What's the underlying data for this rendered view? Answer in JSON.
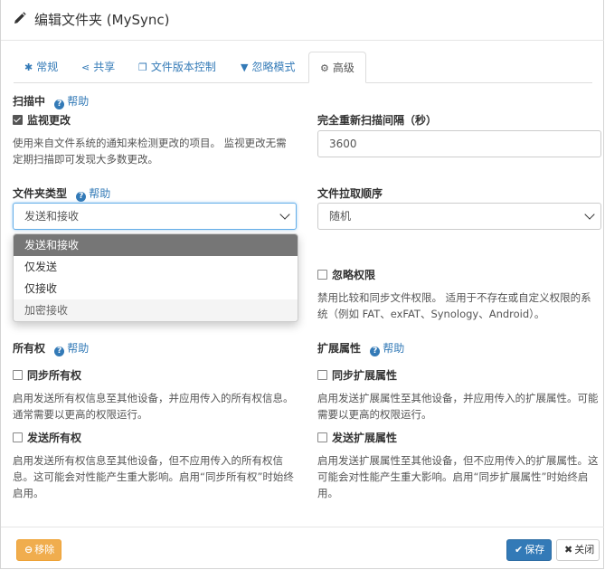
{
  "header": {
    "title": "编辑文件夹 (MySync)",
    "icon": "pencil-icon"
  },
  "tabs": [
    {
      "label": "常规",
      "icon": "gear-icon"
    },
    {
      "label": "共享",
      "icon": "share-icon"
    },
    {
      "label": "文件版本控制",
      "icon": "copy-icon"
    },
    {
      "label": "忽略模式",
      "icon": "filter-icon"
    },
    {
      "label": "高级",
      "icon": "gears-icon",
      "active": true
    }
  ],
  "help_label": "帮助",
  "scanning": {
    "title": "扫描中",
    "watch_label": "监视更改",
    "watch_checked": true,
    "watch_desc": "使用来自文件系统的通知来检测更改的项目。 监视更改无需定期扫描即可发现大多数更改。"
  },
  "rescan": {
    "label": "完全重新扫描间隔（秒）",
    "value": "3600"
  },
  "folder_type": {
    "label": "文件夹类型",
    "selected": "发送和接收",
    "options": [
      "发送和接收",
      "仅发送",
      "仅接收",
      "加密接收"
    ]
  },
  "pull_order": {
    "label": "文件拉取顺序",
    "selected": "随机"
  },
  "ignore_perms": {
    "label": "忽略权限",
    "checked": false,
    "desc": "禁用比较和同步文件权限。 适用于不存在或自定义权限的系统（例如 FAT、exFAT、Synology、Android）。"
  },
  "ownership": {
    "title": "所有权",
    "sync_label": "同步所有权",
    "sync_desc": "启用发送所有权信息至其他设备，并应用传入的所有权信息。通常需要以更高的权限运行。",
    "send_label": "发送所有权",
    "send_desc": "启用发送所有权信息至其他设备，但不应用传入的所有权信息。这可能会对性能产生重大影响。启用“同步所有权”时始终启用。"
  },
  "xattrs": {
    "title": "扩展属性",
    "sync_label": "同步扩展属性",
    "sync_desc": "启用发送扩展属性至其他设备，并应用传入的扩展属性。可能需要以更高的权限运行。",
    "send_label": "发送扩展属性",
    "send_desc": "启用发送扩展属性至其他设备，但不应用传入的扩展属性。这可能会对性能产生重大影响。启用“同步扩展属性”时始终启用。"
  },
  "footer": {
    "remove_label": "移除",
    "save_label": "保存",
    "close_label": "关闭"
  },
  "colors": {
    "primary": "#337ab7",
    "warning": "#f0ad4e",
    "selected_option": "#767676"
  }
}
